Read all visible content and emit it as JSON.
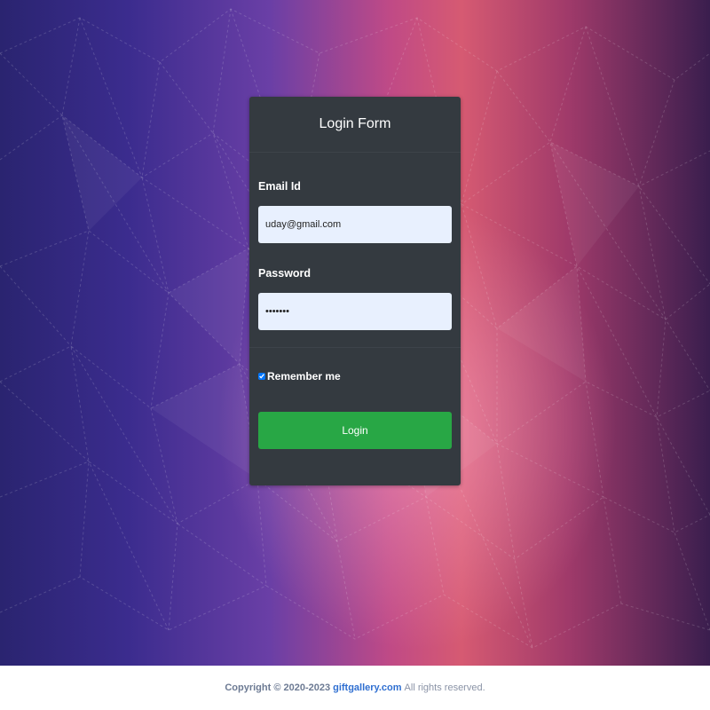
{
  "login_form": {
    "title": "Login Form",
    "email_label": "Email Id",
    "email_value": "uday@gmail.com",
    "password_label": "Password",
    "password_value": "•••••••",
    "remember_label": "Remember me",
    "remember_checked": true,
    "login_button": "Login"
  },
  "footer": {
    "copyright": "Copyright © 2020-2023",
    "site_link": "giftgallery.com",
    "rights": "All rights reserved."
  },
  "colors": {
    "card_bg": "#343a40",
    "input_bg": "#e8f0fe",
    "button_bg": "#28a745",
    "link": "#2f6fd1"
  },
  "icons": {
    "checkbox": "checkbox-checked-icon"
  }
}
